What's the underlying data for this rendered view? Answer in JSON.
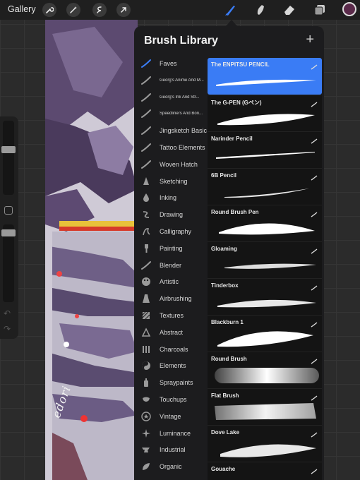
{
  "topbar": {
    "gallery_label": "Gallery",
    "tools": [
      "wrench-icon",
      "magic-wand-icon",
      "selection-icon",
      "transform-icon"
    ],
    "right_tools": [
      "brush-icon",
      "smudge-icon",
      "eraser-icon",
      "layers-icon"
    ],
    "current_color": "#5a2a4a"
  },
  "library": {
    "title": "Brush Library",
    "add_symbol": "+",
    "accent": "#3a7cf5",
    "sets": [
      {
        "label": "Faves",
        "icon": "brush-stroke-icon",
        "active": true
      },
      {
        "label": "Georg's Anime And M...",
        "icon": "brush-stroke-icon",
        "small": true
      },
      {
        "label": "Georg's Ink And Str...",
        "icon": "brush-stroke-icon",
        "small": true
      },
      {
        "label": "Speedliners And Bon...",
        "icon": "brush-stroke-icon",
        "small": true
      },
      {
        "label": "Jingsketch Basics",
        "icon": "brush-stroke-icon"
      },
      {
        "label": "Tattoo Elements",
        "icon": "brush-stroke-icon"
      },
      {
        "label": "Woven Hatch",
        "icon": "brush-stroke-icon"
      },
      {
        "label": "Sketching",
        "icon": "pencil-tip-icon"
      },
      {
        "label": "Inking",
        "icon": "ink-drop-icon"
      },
      {
        "label": "Drawing",
        "icon": "swirl-icon"
      },
      {
        "label": "Calligraphy",
        "icon": "calligraphy-icon"
      },
      {
        "label": "Painting",
        "icon": "paint-brush-icon"
      },
      {
        "label": "Blender",
        "icon": "blender-icon"
      },
      {
        "label": "Artistic",
        "icon": "palette-icon"
      },
      {
        "label": "Airbrushing",
        "icon": "airbrush-icon"
      },
      {
        "label": "Textures",
        "icon": "texture-icon"
      },
      {
        "label": "Abstract",
        "icon": "triangle-icon"
      },
      {
        "label": "Charcoals",
        "icon": "charcoal-icon"
      },
      {
        "label": "Elements",
        "icon": "yin-yang-icon"
      },
      {
        "label": "Spraypaints",
        "icon": "spray-can-icon"
      },
      {
        "label": "Touchups",
        "icon": "touchup-icon"
      },
      {
        "label": "Vintage",
        "icon": "star-badge-icon"
      },
      {
        "label": "Luminance",
        "icon": "sparkle-icon"
      },
      {
        "label": "Industrial",
        "icon": "anvil-icon"
      },
      {
        "label": "Organic",
        "icon": "leaf-icon"
      }
    ],
    "brushes": [
      {
        "name": "The ENPITSU PENCIL",
        "selected": true
      },
      {
        "name": "The G-PEN (Gペン)"
      },
      {
        "name": "Narinder Pencil"
      },
      {
        "name": "6B Pencil"
      },
      {
        "name": "Round Brush Pen"
      },
      {
        "name": "Gloaming"
      },
      {
        "name": "Tinderbox"
      },
      {
        "name": "Blackburn 1"
      },
      {
        "name": "Round Brush"
      },
      {
        "name": "Flat Brush"
      },
      {
        "name": "Dove Lake"
      },
      {
        "name": "Gouache"
      }
    ]
  },
  "canvas": {
    "signature": "edori"
  }
}
